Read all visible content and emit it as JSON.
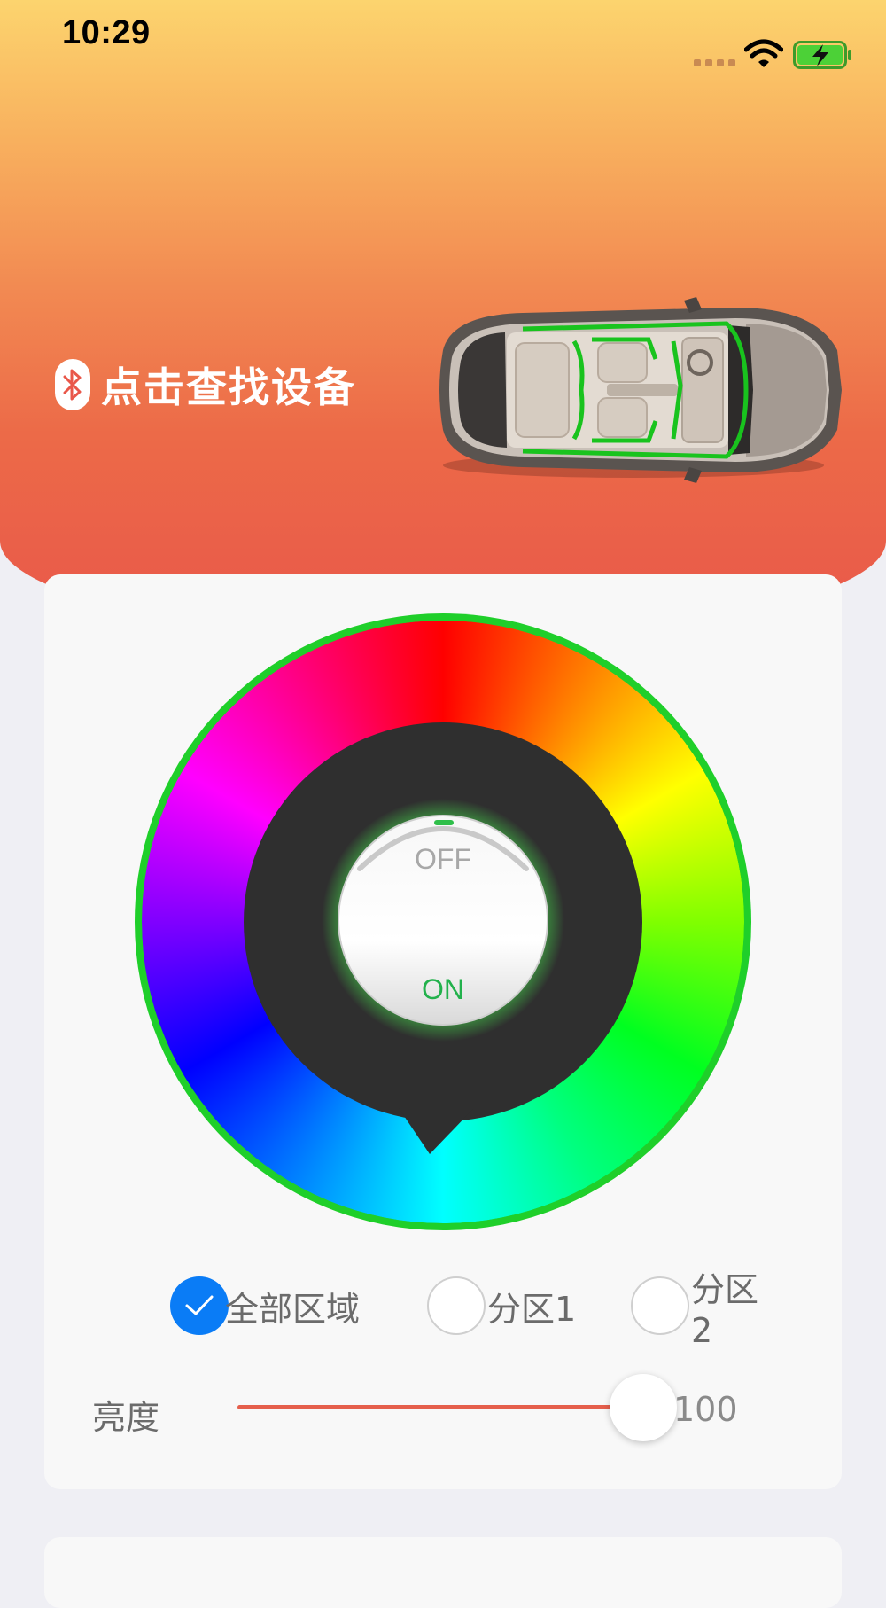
{
  "status_bar": {
    "time": "10:29",
    "icons": [
      "signal-dots-icon",
      "wifi-icon",
      "battery-charging-icon"
    ]
  },
  "header": {
    "find_device_label": "点击查找设备",
    "bluetooth_icon": "bluetooth-icon",
    "car_image": "car-top-view-image"
  },
  "color_wheel": {
    "ring_color": "#1fcf2a",
    "power_switch": {
      "off_label": "OFF",
      "on_label": "ON",
      "on_color": "#22b14c"
    }
  },
  "zones": [
    {
      "label": "全部区域",
      "selected": true
    },
    {
      "label": "分区1",
      "selected": false
    },
    {
      "label": "分区2",
      "selected": false
    }
  ],
  "brightness": {
    "label": "亮度",
    "value": "100",
    "level_fraction": 1.0,
    "track_color": "#e55f4c"
  },
  "colors": {
    "accent": "#0a7cf6",
    "header_top": "#fcd46e",
    "header_bottom": "#e9574a"
  }
}
